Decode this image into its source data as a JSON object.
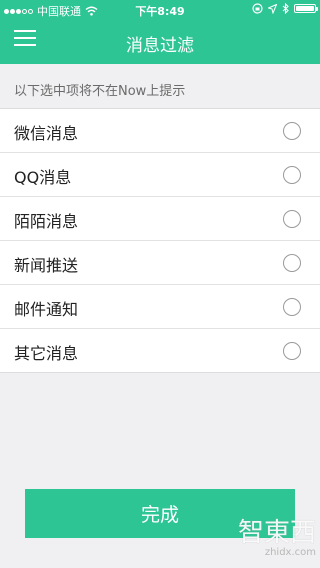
{
  "status_bar": {
    "carrier": "中国联通",
    "time": "下午8:49",
    "battery_level": 1.0
  },
  "header": {
    "title": "消息过滤",
    "menu_icon": "hamburger-menu-icon"
  },
  "hint": "以下选中项将不在Now上提示",
  "options": [
    {
      "label": "微信消息",
      "checked": false
    },
    {
      "label": "QQ消息",
      "checked": false
    },
    {
      "label": "陌陌消息",
      "checked": false
    },
    {
      "label": "新闻推送",
      "checked": false
    },
    {
      "label": "邮件通知",
      "checked": false
    },
    {
      "label": "其它消息",
      "checked": false
    }
  ],
  "done_label": "完成",
  "watermark": {
    "logo": "智東西",
    "url": "zhidx.com"
  },
  "colors": {
    "accent": "#2ec594",
    "background": "#f0f0f2"
  }
}
